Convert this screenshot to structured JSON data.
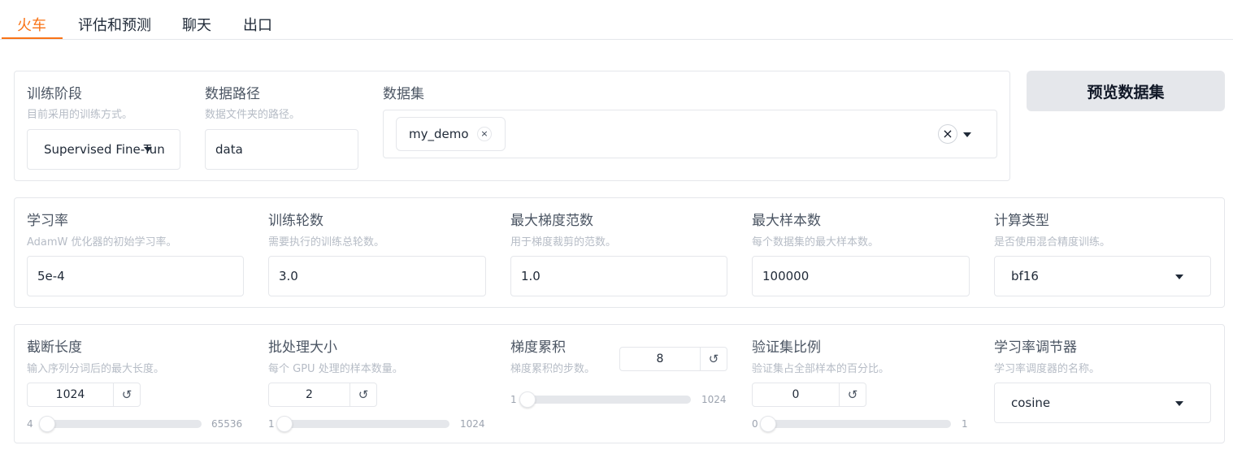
{
  "tabs": [
    {
      "label": "火车",
      "active": true
    },
    {
      "label": "评估和预测",
      "active": false
    },
    {
      "label": "聊天",
      "active": false
    },
    {
      "label": "出口",
      "active": false
    }
  ],
  "accent_color": "#f97316",
  "row1": {
    "stage": {
      "label": "训练阶段",
      "info": "目前采用的训练方式。",
      "value": "Supervised Fine-Tun"
    },
    "dataset_dir": {
      "label": "数据路径",
      "info": "数据文件夹的路径。",
      "value": "data"
    },
    "dataset": {
      "label": "数据集",
      "chips": [
        "my_demo"
      ]
    },
    "preview_button": "预览数据集"
  },
  "row2": {
    "learning_rate": {
      "label": "学习率",
      "info": "AdamW 优化器的初始学习率。",
      "value": "5e-4"
    },
    "num_epochs": {
      "label": "训练轮数",
      "info": "需要执行的训练总轮数。",
      "value": "3.0"
    },
    "max_grad_norm": {
      "label": "最大梯度范数",
      "info": "用于梯度裁剪的范数。",
      "value": "1.0"
    },
    "max_samples": {
      "label": "最大样本数",
      "info": "每个数据集的最大样本数。",
      "value": "100000"
    },
    "compute_type": {
      "label": "计算类型",
      "info": "是否使用混合精度训练。",
      "value": "bf16"
    }
  },
  "row3": {
    "cutoff_len": {
      "label": "截断长度",
      "info": "输入序列分词后的最大长度。",
      "value": "1024",
      "min": "4",
      "max": "65536",
      "fraction": 0.0156
    },
    "batch_size": {
      "label": "批处理大小",
      "info": "每个 GPU 处理的样本数量。",
      "value": "2",
      "min": "1",
      "max": "1024",
      "fraction": 0.001
    },
    "grad_accum": {
      "label": "梯度累积",
      "info": "梯度累积的步数。",
      "value": "8",
      "min": "1",
      "max": "1024",
      "fraction": 0.007
    },
    "val_size": {
      "label": "验证集比例",
      "info": "验证集占全部样本的百分比。",
      "value": "0",
      "min": "0",
      "max": "1",
      "fraction": 0.0
    },
    "lr_scheduler": {
      "label": "学习率调节器",
      "info": "学习率调度器的名称。",
      "value": "cosine"
    }
  },
  "icons": {
    "reset": "↺",
    "chip_remove": "×",
    "clear": "×"
  }
}
